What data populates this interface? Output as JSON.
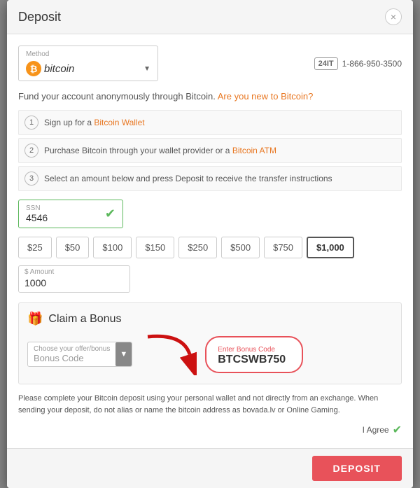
{
  "modal": {
    "title": "Deposit",
    "close_label": "×"
  },
  "method": {
    "label": "Method",
    "value": "Bitcoin",
    "bitcoin_symbol": "₿",
    "bitcoin_text": "bitcoin"
  },
  "support": {
    "badge": "24IT",
    "phone": "1-866-950-3500"
  },
  "intro": {
    "text": "Fund your account anonymously through Bitcoin.",
    "link_text": "Are you new to Bitcoin?"
  },
  "steps": [
    {
      "num": "1",
      "prefix": "Sign up for a ",
      "link_text": "Bitcoin Wallet",
      "suffix": ""
    },
    {
      "num": "2",
      "prefix": "Purchase Bitcoin through your wallet provider or a ",
      "link_text": "Bitcoin ATM",
      "suffix": ""
    },
    {
      "num": "3",
      "prefix": "Select an amount below and press Deposit to receive the transfer instructions",
      "link_text": "",
      "suffix": ""
    }
  ],
  "ssn": {
    "label": "SSN",
    "value": "4546"
  },
  "amounts": [
    {
      "label": "$25",
      "value": 25,
      "active": false
    },
    {
      "label": "$50",
      "value": 50,
      "active": false
    },
    {
      "label": "$100",
      "value": 100,
      "active": false
    },
    {
      "label": "$150",
      "value": 150,
      "active": false
    },
    {
      "label": "$250",
      "value": 250,
      "active": false
    },
    {
      "label": "$500",
      "value": 500,
      "active": false
    },
    {
      "label": "$750",
      "value": 750,
      "active": false
    },
    {
      "label": "$1,000",
      "value": 1000,
      "active": true
    }
  ],
  "amount_input": {
    "label": "$ Amount",
    "value": "1000"
  },
  "bonus": {
    "title": "Claim a Bonus",
    "offer_label": "Choose your offer/bonus",
    "offer_placeholder": "Bonus Code",
    "code_label": "Enter Bonus Code",
    "code_value": "BTCSWB750"
  },
  "disclaimer": {
    "text": "Please complete your Bitcoin deposit using your personal wallet and not directly from an exchange. When sending your deposit, do not alias or name the bitcoin address as bovada.lv or Online Gaming."
  },
  "agree": {
    "label": "I Agree"
  },
  "footer": {
    "deposit_label": "DEPOSIT"
  }
}
